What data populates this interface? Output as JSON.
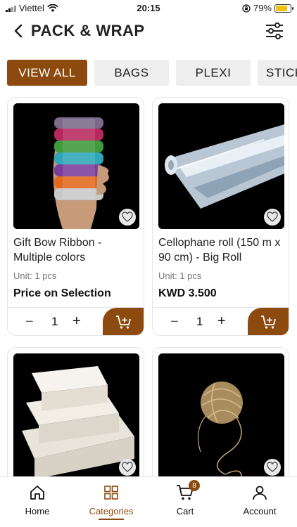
{
  "status_bar": {
    "carrier": "Viettel",
    "time": "20:15",
    "battery_percent": "79%",
    "battery_level": 0.79
  },
  "header": {
    "title": "PACK & WRAP"
  },
  "filters": {
    "chips": [
      "VIEW ALL",
      "BAGS",
      "PLEXI",
      "STICKERS"
    ],
    "active_index": 0
  },
  "products": [
    {
      "name": "Gift Bow Ribbon - Multiple colors",
      "unit": "Unit: 1 pcs",
      "price": "Price on Selection",
      "quantity": "1"
    },
    {
      "name": "Cellophane roll (150 m x 90 cm) - Big Roll",
      "unit": "Unit: 1 pcs",
      "price": "KWD 3.500",
      "quantity": "1"
    }
  ],
  "quantity_controls": {
    "minus": "−",
    "plus": "+"
  },
  "bottom_nav": {
    "items": [
      {
        "label": "Home",
        "icon": "home-icon"
      },
      {
        "label": "Categories",
        "icon": "grid-icon"
      },
      {
        "label": "Cart",
        "icon": "cart-icon",
        "badge": "8"
      },
      {
        "label": "Account",
        "icon": "user-icon"
      }
    ],
    "active_index": 1
  },
  "colors": {
    "accent": "#8c4a0f",
    "chip_background": "#eeeeee",
    "battery": "#f3c20b"
  }
}
